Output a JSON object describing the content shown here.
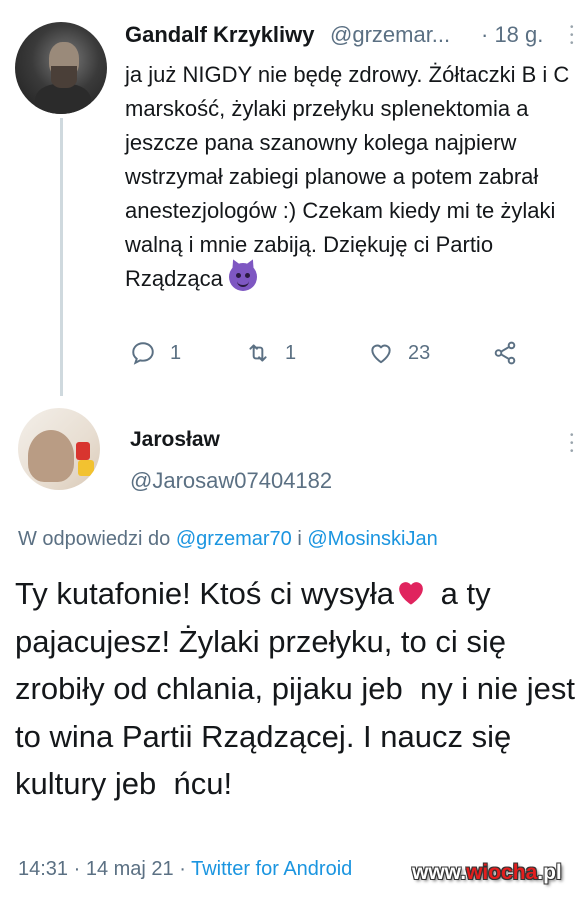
{
  "tweet1": {
    "author_name": "Gandalf Krzykliwy",
    "handle": "@grzemar...",
    "time": "· 18 g.",
    "text": "ja już NIGDY nie będę zdrowy. Żółtaczki B i C marskość, żylaki przełyku splenektomia a jeszcze pana szanowny kolega najpierw wstrzymał zabiegi planowe a potem zabrał anestezjologów :) Czekam kiedy mi te żylaki walną i mnie zabiją. Dziękuję ci Partio Rządząca",
    "emoji": "smiling-imp-emoji",
    "replies": "1",
    "retweets": "1",
    "likes": "23"
  },
  "tweet2": {
    "author_name": "Jarosław",
    "handle": "@Jarosaw07404182",
    "reply_prefix": "W odpowiedzi do",
    "reply_to_1": "@grzemar70",
    "reply_and": "i",
    "reply_to_2": "@MosinskiJan",
    "text_part1": "Ty kutafonie! Ktoś ci wysyła",
    "text_part2": " a ty pajacujesz! Żylaki przełyku, to ci się zrobiły od chlania, pijaku jeb  ny i nie jest to wina Partii Rządzącej. I naucz się kultury jeb  ńcu!",
    "timestamp": "14:31 · 14 maj 21 ·",
    "source": "Twitter for Android"
  },
  "watermark": {
    "prefix": "www.",
    "brand": "wiocha",
    "suffix": ".pl"
  },
  "colors": {
    "link": "#1b95e0",
    "secondary_text": "#5b7083",
    "heart": "#e0245e"
  }
}
